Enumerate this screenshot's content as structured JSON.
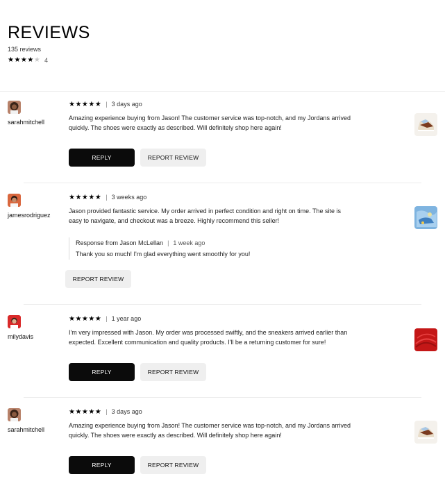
{
  "header": {
    "title": "REVIEWS",
    "review_count": "135 reviews",
    "avg_stars": "★★★★",
    "empty_star": "★",
    "avg_value": "4"
  },
  "reviews": [
    {
      "username": "sarahmitchell",
      "stars": "★★★★★",
      "date": "3 days ago",
      "body": "Amazing experience buying from Jason! The customer service was top-notch, and my Jordans arrived quickly. The shoes were exactly as described. Will definitely shop here again!",
      "reply_label": "REPLY",
      "report_label": "REPORT REVIEW"
    },
    {
      "username": "jamesrodriguez",
      "stars": "★★★★★",
      "date": "3 weeks ago",
      "body": "Jason provided fantastic service. My order arrived in perfect condition and right on time. The site is easy to navigate, and checkout was a breeze. Highly recommend this seller!",
      "response_from": "Response from Jason McLellan",
      "response_date": "1 week ago",
      "response_text": "Thank you so much! I'm glad everything went smoothly for you!",
      "report_label": "REPORT REVIEW"
    },
    {
      "username": "milydavis",
      "stars": "★★★★★",
      "date": "1 year ago",
      "body": "I'm very impressed with Jason. My order was processed swiftly, and the sneakers arrived earlier than expected. Excellent communication and quality products. I'll be a returning customer for sure!",
      "reply_label": "REPLY",
      "report_label": "REPORT REVIEW"
    },
    {
      "username": "sarahmitchell",
      "stars": "★★★★★",
      "date": "3 days ago",
      "body": "Amazing experience buying from Jason! The customer service was top-notch, and my Jordans arrived quickly. The shoes were exactly as described. Will definitely shop here again!",
      "reply_label": "REPLY",
      "report_label": "REPORT REVIEW"
    }
  ],
  "separator": "|"
}
